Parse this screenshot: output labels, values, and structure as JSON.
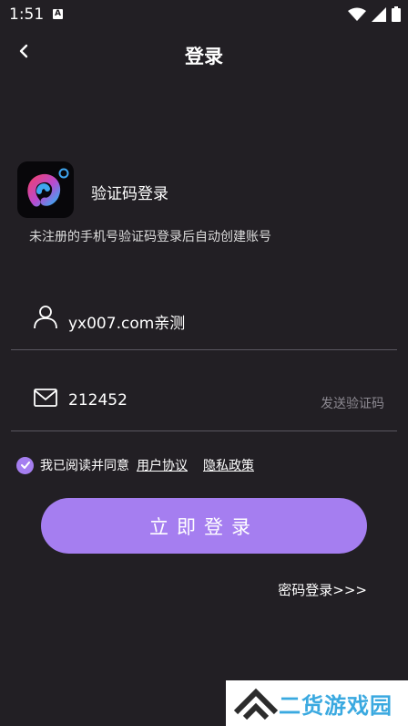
{
  "status_bar": {
    "time": "1:51",
    "app_icon_letter": "A"
  },
  "nav": {
    "title": "登录"
  },
  "login": {
    "heading": "验证码登录",
    "hint": "未注册的手机号验证码登录后自动创建账号",
    "phone_value": "yx007.com亲测",
    "code_value": "212452",
    "send_code_label": "发送验证码",
    "agree_prefix": "我已阅读并同意",
    "user_agreement": "用户协议",
    "privacy_policy": "隐私政策",
    "submit_label": "立即登录",
    "password_login": "密码登录>>>"
  },
  "watermark": {
    "text": "二货游戏园"
  },
  "colors": {
    "background": "#221f24",
    "accent": "#a57ef0",
    "watermark_text": "#3aa9e0"
  }
}
